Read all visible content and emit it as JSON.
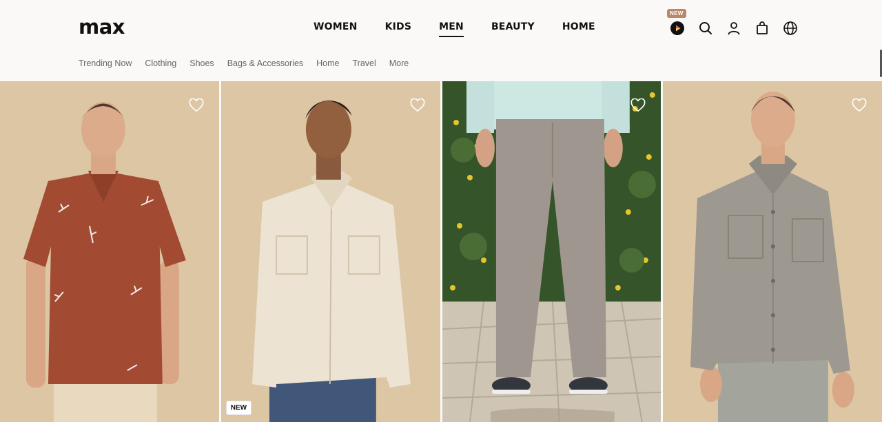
{
  "brand": {
    "logo_text": "max"
  },
  "main_nav": {
    "items": [
      {
        "label": "WOMEN",
        "active": false
      },
      {
        "label": "KIDS",
        "active": false
      },
      {
        "label": "MEN",
        "active": true
      },
      {
        "label": "BEAUTY",
        "active": false
      },
      {
        "label": "HOME",
        "active": false
      }
    ]
  },
  "header_icons": {
    "new_badge": "NEW",
    "items": [
      "play-video-icon",
      "search-icon",
      "user-icon",
      "shopping-bag-icon",
      "globe-icon"
    ]
  },
  "sub_nav": {
    "items": [
      "Trending Now",
      "Clothing",
      "Shoes",
      "Bags & Accessories",
      "Home",
      "Travel",
      "More"
    ]
  },
  "products": [
    {
      "image": "man-rust-floral-shirt",
      "badge": ""
    },
    {
      "image": "man-beige-overshirt",
      "badge": "NEW"
    },
    {
      "image": "grey-trousers-outdoor",
      "badge": ""
    },
    {
      "image": "man-grey-overshirt",
      "badge": ""
    }
  ],
  "colors": {
    "card_bg": "#dcc6a4",
    "header_bg": "#fbf9f7",
    "new_badge": "#b9876a"
  }
}
